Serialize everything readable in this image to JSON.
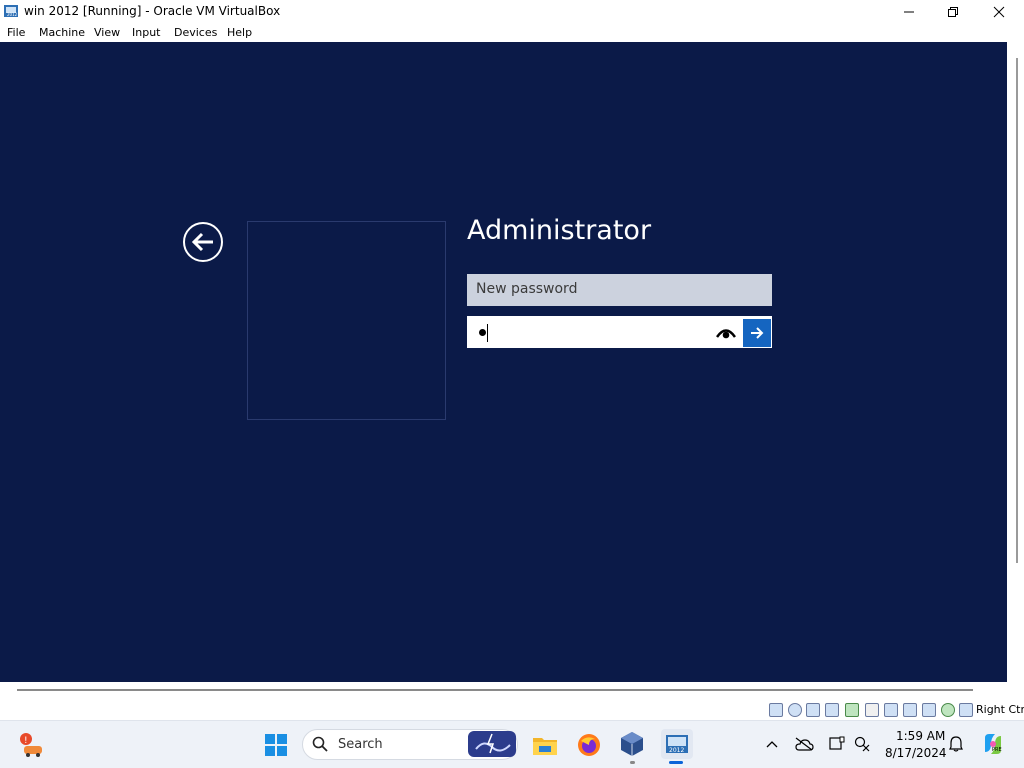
{
  "window": {
    "title": "win 2012 [Running] - Oracle VM VirtualBox"
  },
  "menu": {
    "items": [
      "File",
      "Machine",
      "View",
      "Input",
      "Devices",
      "Help"
    ]
  },
  "login": {
    "username": "Administrator",
    "new_password_label": "New password",
    "password_value": "•"
  },
  "statusbar": {
    "host_key": "Right Ctrl"
  },
  "taskbar": {
    "search_placeholder": "Search",
    "time": "1:59 AM",
    "date": "8/17/2024"
  },
  "colors": {
    "vm_background": "#0b1a48",
    "submit_button": "#1565c0",
    "password_label_field": "#ccd2de"
  }
}
